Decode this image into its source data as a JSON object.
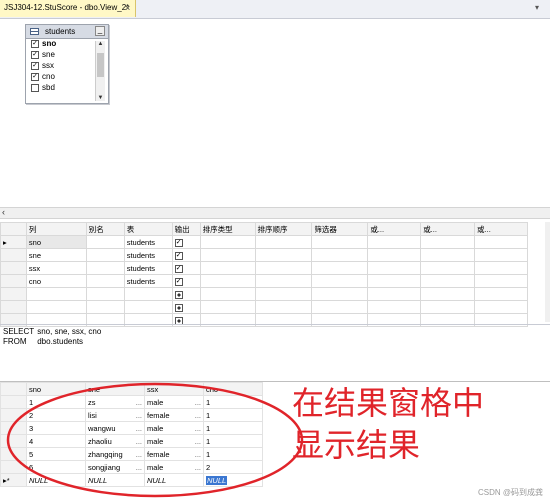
{
  "tab": {
    "title": "JSJ304-12.StuScore - dbo.View_2*",
    "close": "×",
    "dropdown": "▾"
  },
  "diagram": {
    "table_name": "students",
    "columns": [
      {
        "name": "sno",
        "checked": true,
        "key": true
      },
      {
        "name": "sne",
        "checked": true,
        "key": false
      },
      {
        "name": "ssx",
        "checked": true,
        "key": false
      },
      {
        "name": "cno",
        "checked": true,
        "key": false
      },
      {
        "name": "sbd",
        "checked": false,
        "key": false
      }
    ]
  },
  "criteria": {
    "headers": [
      "列",
      "别名",
      "表",
      "输出",
      "排序类型",
      "排序顺序",
      "筛选器",
      "或...",
      "或...",
      "或..."
    ],
    "rows": [
      {
        "column": "sno",
        "alias": "",
        "table": "students",
        "output": "checked"
      },
      {
        "column": "sne",
        "alias": "",
        "table": "students",
        "output": "checked"
      },
      {
        "column": "ssx",
        "alias": "",
        "table": "students",
        "output": "checked"
      },
      {
        "column": "cno",
        "alias": "",
        "table": "students",
        "output": "checked"
      },
      {
        "column": "",
        "alias": "",
        "table": "",
        "output": "indeterminate"
      },
      {
        "column": "",
        "alias": "",
        "table": "",
        "output": "indeterminate"
      },
      {
        "column": "",
        "alias": "",
        "table": "",
        "output": "indeterminate"
      }
    ]
  },
  "sql": {
    "select_kw": "SELECT",
    "select_cols": "sno, sne, ssx, cno",
    "from_kw": "FROM",
    "from_table": "dbo.students"
  },
  "results": {
    "headers": [
      "sno",
      "sne",
      "ssx",
      "cno"
    ],
    "rows": [
      [
        "1",
        "zs",
        "male",
        "1"
      ],
      [
        "2",
        "lisi",
        "female",
        "1"
      ],
      [
        "3",
        "wangwu",
        "male",
        "1"
      ],
      [
        "4",
        "zhaoliu",
        "male",
        "1"
      ],
      [
        "5",
        "zhangqing",
        "female",
        "1"
      ],
      [
        "6",
        "songjiang",
        "male",
        "2"
      ]
    ],
    "new_row": [
      "NULL",
      "NULL",
      "NULL",
      "NULL"
    ],
    "new_row_marker": "▸*"
  },
  "annotation": {
    "line1": "在结果窗格中",
    "line2": "显示结果",
    "color": "#e0242a"
  },
  "watermark": "CSDN @码到成龚"
}
